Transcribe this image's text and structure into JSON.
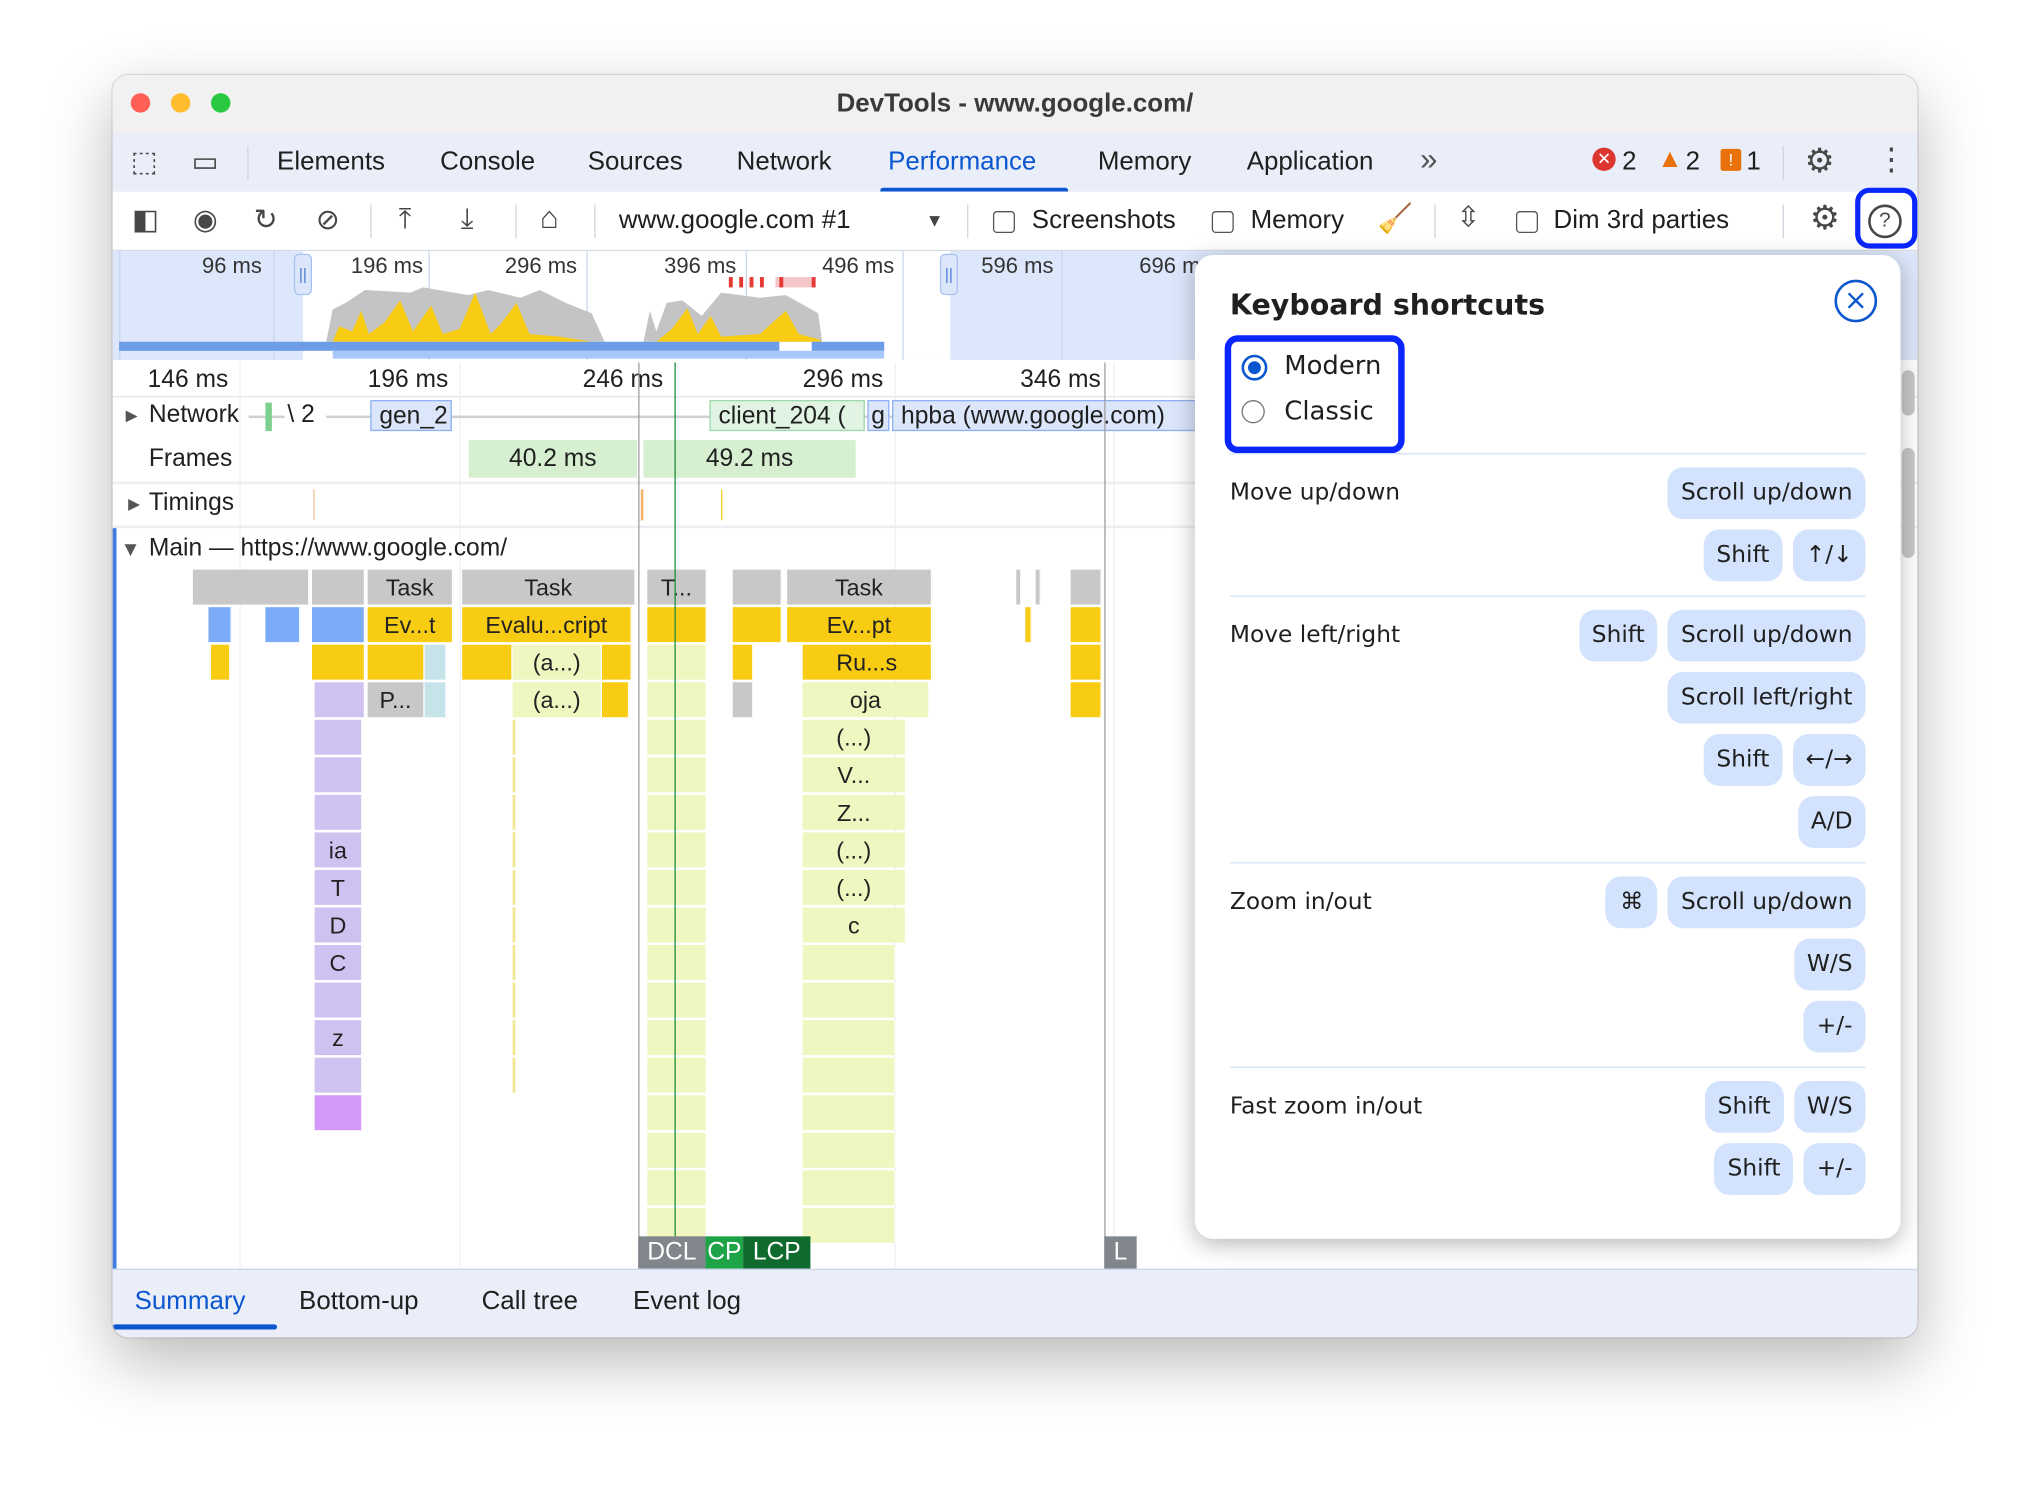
{
  "window": {
    "title": "DevTools - www.google.com/"
  },
  "tabs": [
    {
      "label": "Elements"
    },
    {
      "label": "Console"
    },
    {
      "label": "Sources"
    },
    {
      "label": "Network"
    },
    {
      "label": "Performance",
      "active": true
    },
    {
      "label": "Memory"
    },
    {
      "label": "Application"
    }
  ],
  "tabbar": {
    "more": "»",
    "errors": "2",
    "warnings": "2",
    "issues": "1"
  },
  "toolbar": {
    "target": "www.google.com #1",
    "screenshots_label": "Screenshots",
    "screenshots_checked": false,
    "memory_label": "Memory",
    "memory_checked": false,
    "dim_label": "Dim 3rd parties",
    "dim_checked": false
  },
  "overview": {
    "ticks": [
      "96 ms",
      "196 ms",
      "296 ms",
      "396 ms",
      "496 ms",
      "596 ms",
      "696 ms"
    ]
  },
  "ruler": {
    "ticks": [
      "146 ms",
      "196 ms",
      "246 ms",
      "296 ms",
      "346 ms"
    ]
  },
  "tracks": {
    "network": {
      "label": "Network",
      "items": [
        "\\ 2",
        "gen_2",
        "client_204 (",
        "g",
        "hpba (www.google.com)"
      ]
    },
    "frames": {
      "label": "Frames",
      "items": [
        "40.2 ms",
        "49.2 ms"
      ]
    },
    "timings": {
      "label": "Timings"
    },
    "main": {
      "label": "Main — https://www.google.com/"
    }
  },
  "flame": {
    "task": "Task",
    "t_short": "T...",
    "ev_t": "Ev...t",
    "evalu": "Evalu...cript",
    "ev_pt": "Ev...pt",
    "anon": "(a...)",
    "ru_s": "Ru...s",
    "p": "P...",
    "oja": "oja",
    "paren": "(...)",
    "v": "V...",
    "z_dots": "Z...",
    "ia": "ia",
    "T": "T",
    "D": "D",
    "C": "C",
    "z": "z",
    "c": "c"
  },
  "markers": {
    "dcl": "DCL",
    "cp": "CP",
    "lcp": "LCP",
    "l": "L"
  },
  "bottom_tabs": [
    {
      "label": "Summary",
      "active": true
    },
    {
      "label": "Bottom-up"
    },
    {
      "label": "Call tree"
    },
    {
      "label": "Event log"
    }
  ],
  "shortcuts": {
    "title": "Keyboard shortcuts",
    "modes": [
      {
        "label": "Modern",
        "selected": true
      },
      {
        "label": "Classic",
        "selected": false
      }
    ],
    "sections": [
      {
        "label": "Move up/down",
        "keys": [
          [
            "Scroll up/down"
          ],
          [
            "Shift",
            "↑/↓"
          ]
        ]
      },
      {
        "label": "Move left/right",
        "keys": [
          [
            "Shift",
            "Scroll up/down"
          ],
          [
            "Scroll left/right"
          ],
          [
            "Shift",
            "←/→"
          ],
          [
            "A/D"
          ]
        ]
      },
      {
        "label": "Zoom in/out",
        "keys": [
          [
            "⌘",
            "Scroll up/down"
          ],
          [
            "W/S"
          ],
          [
            "+/-"
          ]
        ]
      },
      {
        "label": "Fast zoom in/out",
        "keys": [
          [
            "Shift",
            "W/S"
          ],
          [
            "Shift",
            "+/-"
          ]
        ]
      }
    ]
  },
  "colors": {
    "accent": "#0b57d0",
    "highlight": "#0a26ff",
    "task": "#c8c8c8",
    "script": "#f9cc14",
    "key_bg": "#d3e3fd"
  }
}
